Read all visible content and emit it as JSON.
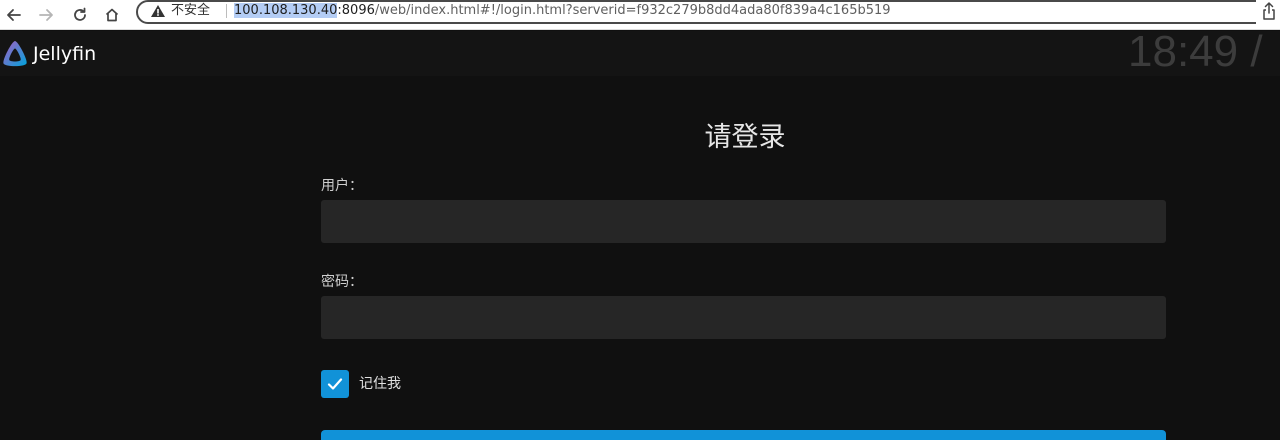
{
  "browser": {
    "insecure_label": "不安全",
    "url_host": "100.108.130.40",
    "url_port": ":8096",
    "url_path": "/web/index.html#!/login.html?serverid=f932c279b8dd4ada80f839a4c165b519"
  },
  "app": {
    "brand": "Jellyfin",
    "clock": "18:49 /"
  },
  "login": {
    "title": "请登录",
    "username_label": "用户：",
    "username_value": "",
    "password_label": "密码：",
    "password_value": "",
    "remember_label": "记住我",
    "remember_checked": true
  },
  "colors": {
    "accent": "#1192d8",
    "background": "#101010",
    "input_background": "#262626"
  }
}
